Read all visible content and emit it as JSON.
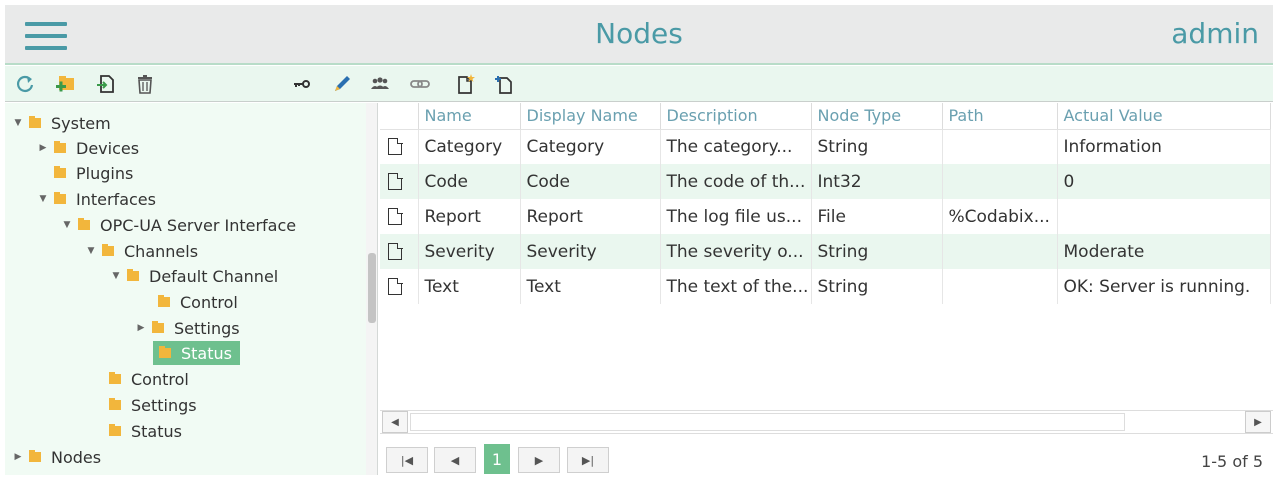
{
  "header": {
    "title": "Nodes",
    "user": "admin"
  },
  "toolbar": {
    "icons": [
      "refresh-icon",
      "add-folder-icon",
      "import-icon",
      "delete-icon",
      "key-icon",
      "edit-icon",
      "users-icon",
      "link-icon",
      "new-document-icon",
      "new-node-icon"
    ]
  },
  "tree": {
    "system": "System",
    "devices": "Devices",
    "plugins": "Plugins",
    "interfaces": "Interfaces",
    "opcua": "OPC-UA Server Interface",
    "channels": "Channels",
    "default_channel": "Default Channel",
    "control": "Control",
    "settings": "Settings",
    "status": "Status",
    "control2": "Control",
    "settings2": "Settings",
    "status2": "Status",
    "nodes": "Nodes"
  },
  "grid": {
    "columns": [
      "Name",
      "Display Name",
      "Description",
      "Node Type",
      "Path",
      "Actual Value"
    ],
    "rows": [
      [
        "Category",
        "Category",
        "The category...",
        "String",
        "",
        "Information"
      ],
      [
        "Code",
        "Code",
        "The code of th...",
        "Int32",
        "",
        "0"
      ],
      [
        "Report",
        "Report",
        "The log file us...",
        "File",
        "%Codabix...",
        ""
      ],
      [
        "Severity",
        "Severity",
        "The severity o...",
        "String",
        "",
        "Moderate"
      ],
      [
        "Text",
        "Text",
        "The text of the...",
        "String",
        "",
        "OK: Server is running."
      ]
    ]
  },
  "pager": {
    "page": "1",
    "info": "1-5 of 5"
  },
  "colors": {
    "accent": "#4a9aa6",
    "selected": "#6ec08e",
    "folder": "#f2b63c",
    "row_alt": "#eaf7ef"
  }
}
